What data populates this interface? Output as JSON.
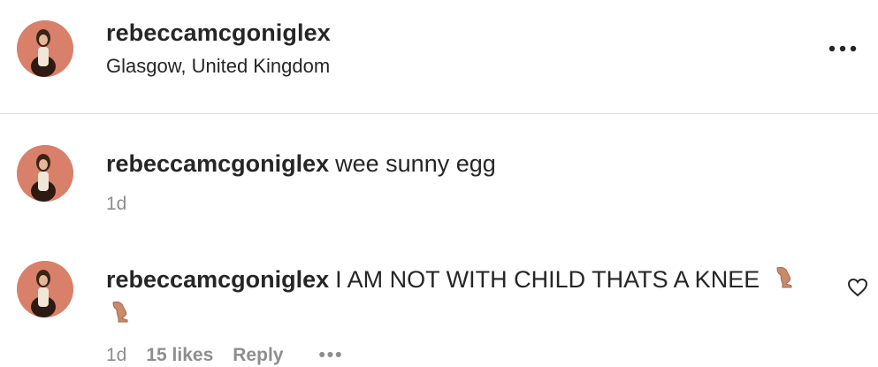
{
  "post_header": {
    "username": "rebeccamcgoniglex",
    "location": "Glasgow, United Kingdom",
    "more_icon": "ellipsis-icon"
  },
  "comments": [
    {
      "username": "rebeccamcgoniglex",
      "text": "wee sunny egg",
      "time": "1d"
    },
    {
      "username": "rebeccamcgoniglex",
      "text": "I AM NOT WITH CHILD THATS A KNEE",
      "emoji": "leg-emoji",
      "time": "1d",
      "likes": "15 likes",
      "reply": "Reply",
      "more": "•••",
      "like_icon": "heart-icon"
    }
  ]
}
